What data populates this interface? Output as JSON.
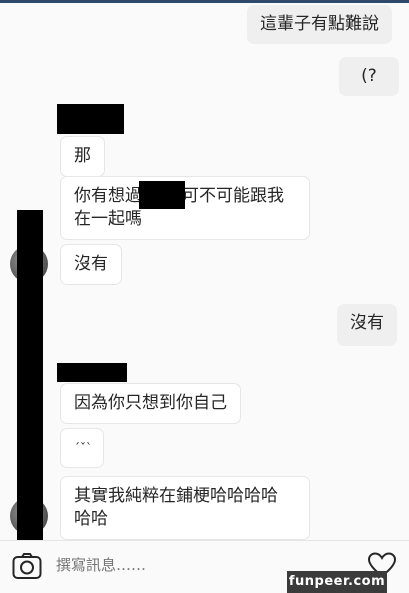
{
  "messages": [
    {
      "side": "out",
      "text": "這輩子有點難說"
    },
    {
      "side": "out",
      "text": "(?"
    },
    {
      "side": "in",
      "text": "那"
    },
    {
      "side": "in",
      "text_line1": "你有想過",
      "text_line1b": "可不可能跟我",
      "text_line2": "在一起嗎"
    },
    {
      "side": "in",
      "text": "沒有"
    },
    {
      "side": "out",
      "text": "沒有"
    },
    {
      "side": "in",
      "text": "因為你只想到你自己"
    },
    {
      "side": "in",
      "text": "ˊˇˋ"
    },
    {
      "side": "in",
      "text_line1": "其實我純粹在鋪梗哈哈哈哈",
      "text_line2": "哈哈"
    }
  ],
  "composer": {
    "placeholder": "撰寫訊息……"
  },
  "icons": {
    "left": "camera-icon",
    "right": "heart-icon"
  },
  "watermark": {
    "text": "funpeer.com"
  }
}
